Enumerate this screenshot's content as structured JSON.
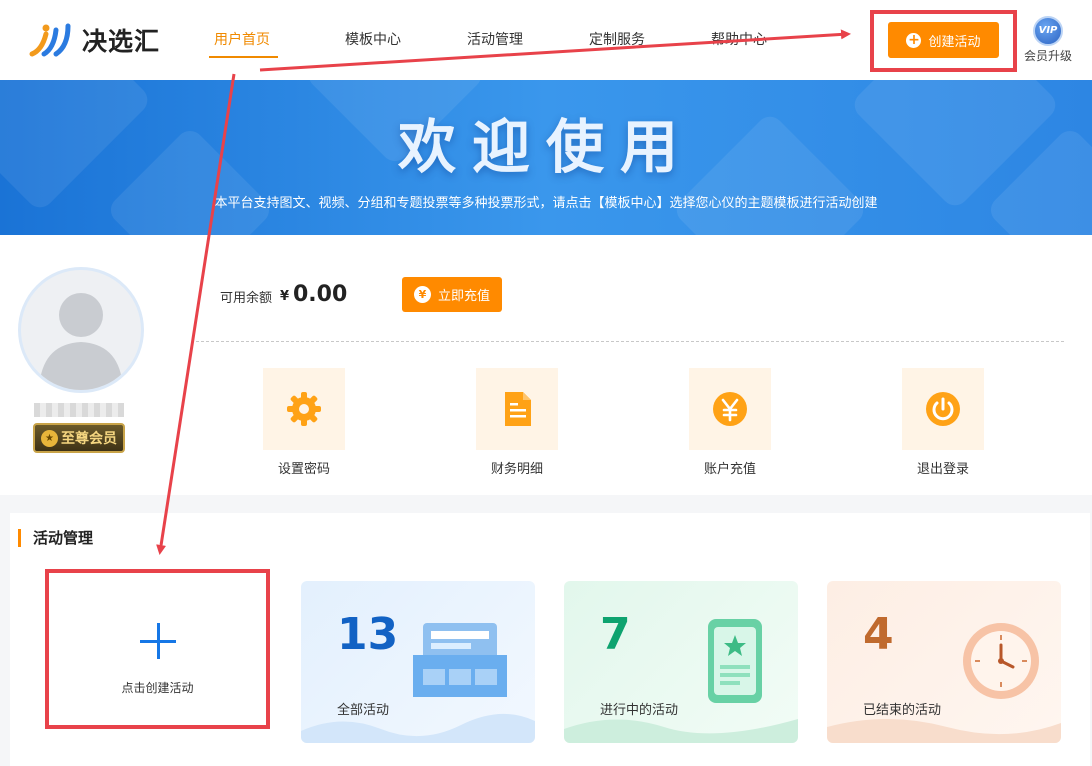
{
  "header": {
    "logo_text": "决选汇",
    "nav": [
      "用户首页",
      "模板中心",
      "活动管理",
      "定制服务",
      "帮助中心"
    ],
    "create_button": "创建活动",
    "vip_badge": "VIP",
    "vip_label": "会员升级"
  },
  "banner": {
    "title": "欢迎使用",
    "subtitle": "本平台支持图文、视频、分组和专题投票等多种投票形式，请点击【模板中心】选择您心仪的主题模板进行活动创建"
  },
  "profile": {
    "member_level": "至尊会员",
    "balance_label": "可用余额",
    "balance_currency": "¥",
    "balance_value": "0.00",
    "recharge_button": "立即充值",
    "quick_actions": [
      {
        "label": "设置密码",
        "icon": "gear-icon"
      },
      {
        "label": "财务明细",
        "icon": "document-icon"
      },
      {
        "label": "账户充值",
        "icon": "yen-icon"
      },
      {
        "label": "退出登录",
        "icon": "power-icon"
      }
    ]
  },
  "activities": {
    "section_title": "活动管理",
    "create_card_label": "点击创建活动",
    "stats": [
      {
        "value": "13",
        "label": "全部活动",
        "color": "#1262c4"
      },
      {
        "value": "7",
        "label": "进行中的活动",
        "color": "#0ea36f"
      },
      {
        "value": "4",
        "label": "已结束的活动",
        "color": "#c06a2e"
      }
    ]
  },
  "colors": {
    "accent": "#ff8a00",
    "banner": "#2d86e3",
    "annotation": "#e8424a"
  }
}
